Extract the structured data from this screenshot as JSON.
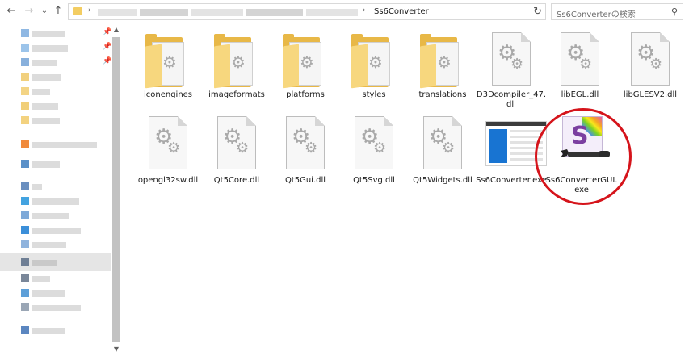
{
  "address_bar": {
    "current_folder": "Ss6Converter",
    "search_placeholder": "Ss6Converterの検索"
  },
  "nav": {
    "back": "←",
    "forward": "→",
    "recent": "⌄",
    "up": "↑",
    "refresh": "↻",
    "search_icon": "⚲"
  },
  "files": [
    {
      "name": "iconengines",
      "kind": "folder"
    },
    {
      "name": "imageformats",
      "kind": "folder"
    },
    {
      "name": "platforms",
      "kind": "folder"
    },
    {
      "name": "styles",
      "kind": "folder"
    },
    {
      "name": "translations",
      "kind": "folder"
    },
    {
      "name": "D3Dcompiler_47.dll",
      "kind": "dll"
    },
    {
      "name": "libEGL.dll",
      "kind": "dll"
    },
    {
      "name": "libGLESV2.dll",
      "kind": "dll"
    },
    {
      "name": "opengl32sw.dll",
      "kind": "dll"
    },
    {
      "name": "Qt5Core.dll",
      "kind": "dll"
    },
    {
      "name": "Qt5Gui.dll",
      "kind": "dll"
    },
    {
      "name": "Qt5Svg.dll",
      "kind": "dll"
    },
    {
      "name": "Qt5Widgets.dll",
      "kind": "dll"
    },
    {
      "name": "Ss6Converter.exe",
      "kind": "exe"
    },
    {
      "name": "Ss6ConverterGUI.exe",
      "kind": "gui-exe",
      "highlighted": true
    }
  ],
  "labels": {
    "d3d_line1": "D3Dcompiler_47.",
    "d3d_line2": "dll",
    "gui_line1": "Ss6ConverterGUI.",
    "gui_line2": "exe"
  },
  "colors": {
    "folder": "#e8b847",
    "highlight_ring": "#d5141b",
    "exe_blue": "#1874d2",
    "gui_purple": "#7b3fa0"
  }
}
